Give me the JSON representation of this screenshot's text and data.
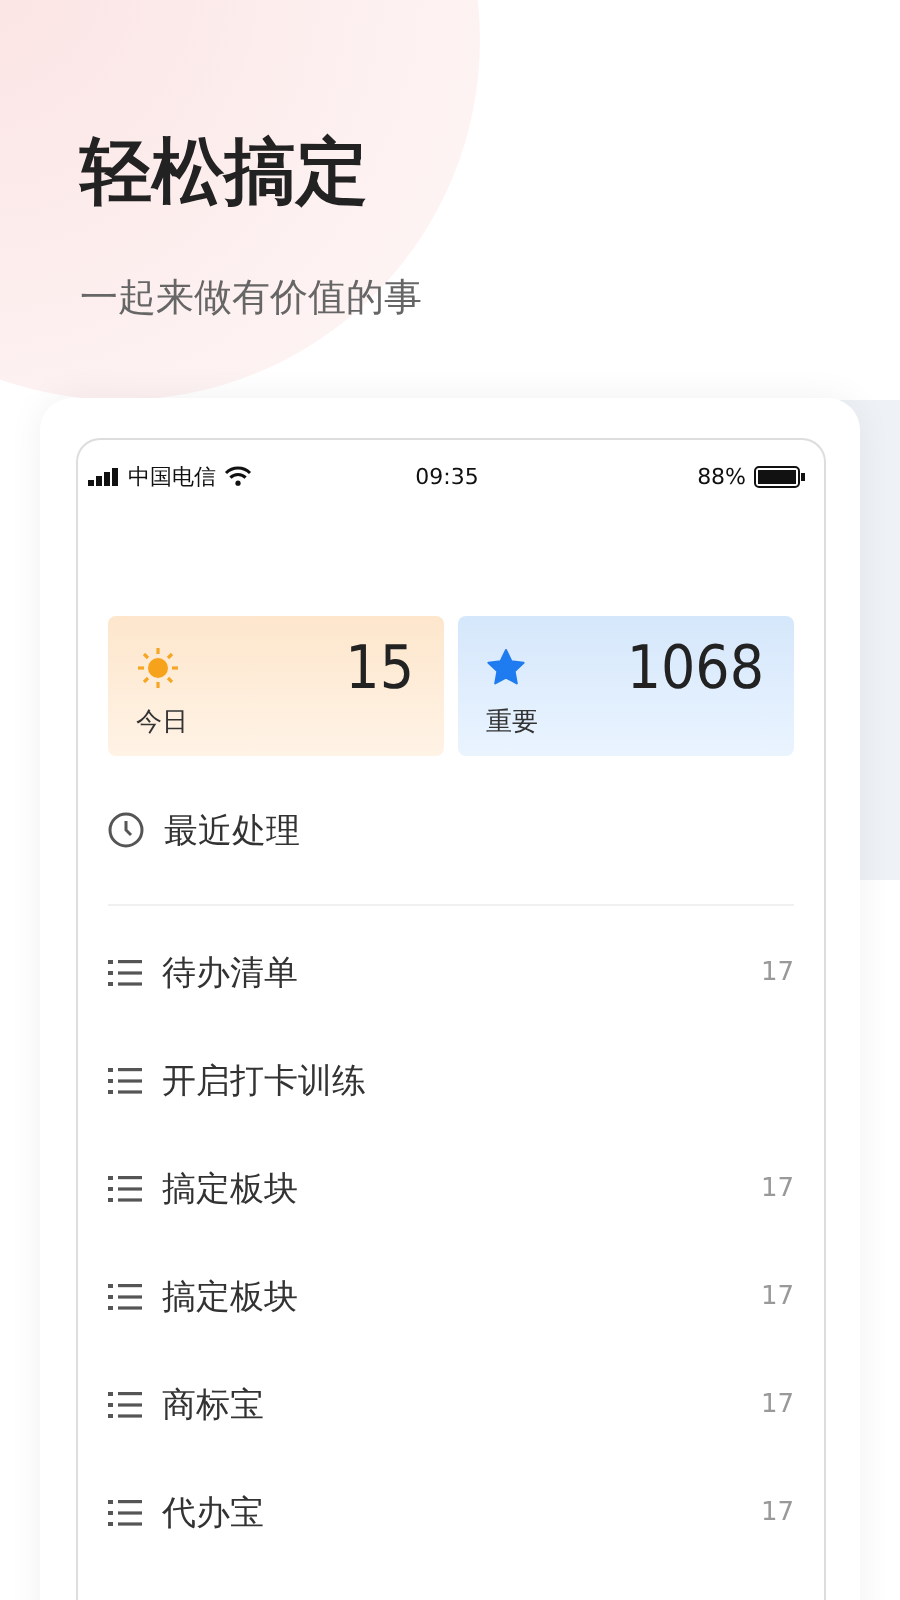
{
  "header": {
    "title": "轻松搞定",
    "subtitle": "一起来做有价值的事"
  },
  "status_bar": {
    "carrier": "中国电信",
    "time": "09:35",
    "battery": "88%"
  },
  "stats": [
    {
      "kind": "sun",
      "value": "15",
      "label": "今日"
    },
    {
      "kind": "star",
      "value": "1068",
      "label": "重要"
    }
  ],
  "recent": {
    "label": "最近处理"
  },
  "lists": [
    {
      "name": "待办清单",
      "count": "17"
    },
    {
      "name": "开启打卡训练"
    },
    {
      "name": "搞定板块",
      "count": "17"
    },
    {
      "name": "搞定板块",
      "count": "17"
    },
    {
      "name": "商标宝",
      "count": "17"
    },
    {
      "name": "代办宝",
      "count": "17"
    }
  ]
}
